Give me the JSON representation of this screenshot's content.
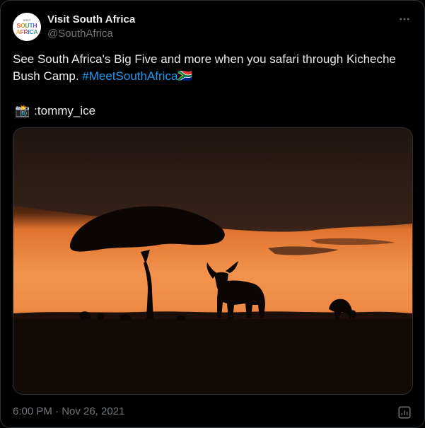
{
  "account": {
    "name": "Visit South Africa",
    "handle": "@SouthAfrica",
    "avatar_lines": [
      "VISIT",
      "SOUTH",
      "AFRICA"
    ]
  },
  "tweet": {
    "text": "See South Africa's Big Five and more when you safari through Kicheche Bush Camp.",
    "hashtag": "#MeetSouthAfrica",
    "flag": "🇿🇦",
    "camera_emoji": "📸",
    "credit": ":tommy_ice",
    "timestamp": "6:00 PM · Nov 26, 2021"
  },
  "icons": {
    "more": "more-options-icon",
    "analytics": "analytics-icon"
  },
  "colors": {
    "background": "#000000",
    "text": "#e7e9ea",
    "muted": "#71767b",
    "link": "#1d9bf0",
    "border": "#2f3336"
  }
}
